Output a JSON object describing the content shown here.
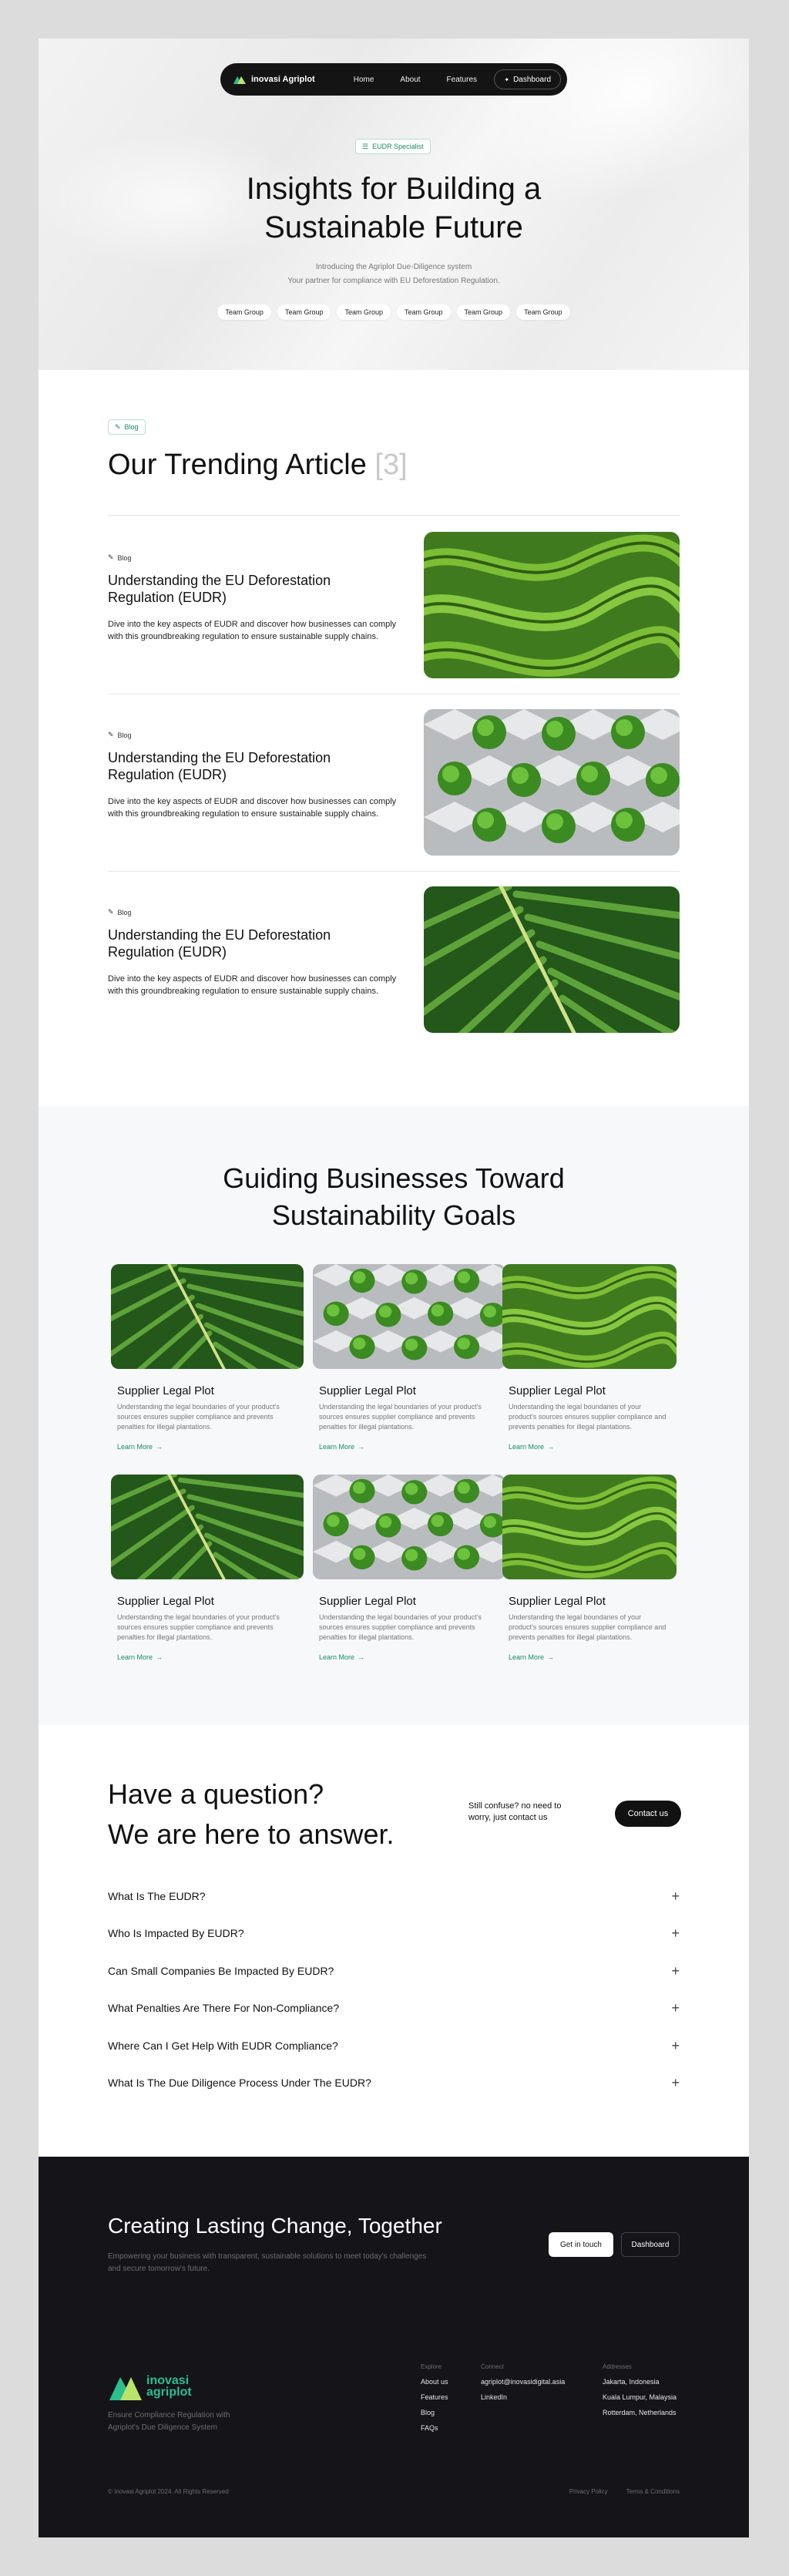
{
  "nav": {
    "brand": "inovasi Agriplot",
    "links": [
      "Home",
      "About",
      "Features"
    ],
    "dashboard": "Dashboard"
  },
  "hero": {
    "badge": "EUDR Specialist",
    "title": "Insights for Building a Sustainable Future",
    "sub1": "Introducing the Agriplot Due-Diligence system",
    "sub2": "Your partner for compliance with EU Deforestation Regulation.",
    "tags": [
      "Team Group",
      "Team Group",
      "Team Group",
      "Team Group",
      "Team Group",
      "Team Group"
    ]
  },
  "trending": {
    "tag": "Blog",
    "title": "Our Trending Article",
    "count": "[3]",
    "articles": [
      {
        "meta": "Blog",
        "title": "Understanding the EU Deforestation Regulation (EUDR)",
        "text": "Dive into the key aspects of EUDR and discover how businesses can comply with this groundbreaking regulation to ensure sustainable supply chains.",
        "image": "maze-hedge"
      },
      {
        "meta": "Blog",
        "title": "Understanding the EU Deforestation Regulation (EUDR)",
        "text": "Dive into the key aspects of EUDR and discover how businesses can comply with this groundbreaking regulation to ensure sustainable supply chains.",
        "image": "boxes-trees"
      },
      {
        "meta": "Blog",
        "title": "Understanding the EU Deforestation Regulation (EUDR)",
        "text": "Dive into the key aspects of EUDR and discover how businesses can comply with this groundbreaking regulation to ensure sustainable supply chains.",
        "image": "palm-leaf"
      }
    ]
  },
  "guiding": {
    "title_line1": "Guiding Businesses Toward",
    "title_line2": "Sustainability Goals",
    "cards": [
      {
        "title": "Supplier Legal Plot",
        "text": "Understanding the legal boundaries of your product's sources ensures supplier compliance and prevents penalties for illegal plantations.",
        "link": "Learn More",
        "image": "palm-leaf"
      },
      {
        "title": "Supplier Legal Plot",
        "text": "Understanding the legal boundaries of your product's sources ensures supplier compliance and prevents penalties for illegal plantations.",
        "link": "Learn More",
        "image": "boxes-trees"
      },
      {
        "title": "Supplier Legal Plot",
        "text": "Understanding the legal boundaries of your product's sources ensures supplier compliance and prevents penalties for illegal plantations.",
        "link": "Learn More",
        "image": "maze-hedge"
      },
      {
        "title": "Supplier Legal Plot",
        "text": "Understanding the legal boundaries of your product's sources ensures supplier compliance and prevents penalties for illegal plantations.",
        "link": "Learn More",
        "image": "palm-leaf"
      },
      {
        "title": "Supplier Legal Plot",
        "text": "Understanding the legal boundaries of your product's sources ensures supplier compliance and prevents penalties for illegal plantations.",
        "link": "Learn More",
        "image": "boxes-trees"
      },
      {
        "title": "Supplier Legal Plot",
        "text": "Understanding the legal boundaries of your product's sources ensures supplier compliance and prevents penalties for illegal plantations.",
        "link": "Learn More",
        "image": "maze-hedge"
      }
    ]
  },
  "faq": {
    "title_line1": "Have a question?",
    "title_line2": "We are here to answer.",
    "confuse": "Still confuse? no need to worry, just contact us",
    "contact": "Contact us",
    "items": [
      "What Is The EUDR?",
      "Who Is Impacted By EUDR?",
      "Can Small Companies Be Impacted By EUDR?",
      "What Penalties Are There For Non-Compliance?",
      "Where Can I Get Help With EUDR Compliance?",
      "What Is The Due Diligence Process Under The EUDR?"
    ]
  },
  "footer": {
    "title": "Creating Lasting Change, Together",
    "lead": "Empowering your business with transparent, sustainable solutions to meet today's challenges and secure tomorrow's future.",
    "touch": "Get in touch",
    "dashboard": "Dashboard",
    "logo_line1": "inovasi",
    "logo_line2": "agriplot",
    "desc": "Ensure Compliance Regulation with Agriplot's Due Diligence System",
    "explore": {
      "heading": "Explore",
      "links": [
        "About us",
        "Features",
        "Blog",
        "FAQs"
      ]
    },
    "connect": {
      "heading": "Connect",
      "links": [
        "agriplot@inovasidigital.asia",
        "LinkedIn"
      ]
    },
    "addresses": {
      "heading": "Addresses",
      "links": [
        "Jakarta, Indonesia",
        "Kuala Lumpur, Malaysia",
        "Rotterdam, Netherlands"
      ]
    },
    "copyright": "© Inovasi Agriplot 2024. All Rights Reserved",
    "privacy": "Privacy Policy",
    "terms": "Terms & Conditions"
  },
  "colors": {
    "accent": "#1a8a66",
    "dark": "#141419"
  }
}
